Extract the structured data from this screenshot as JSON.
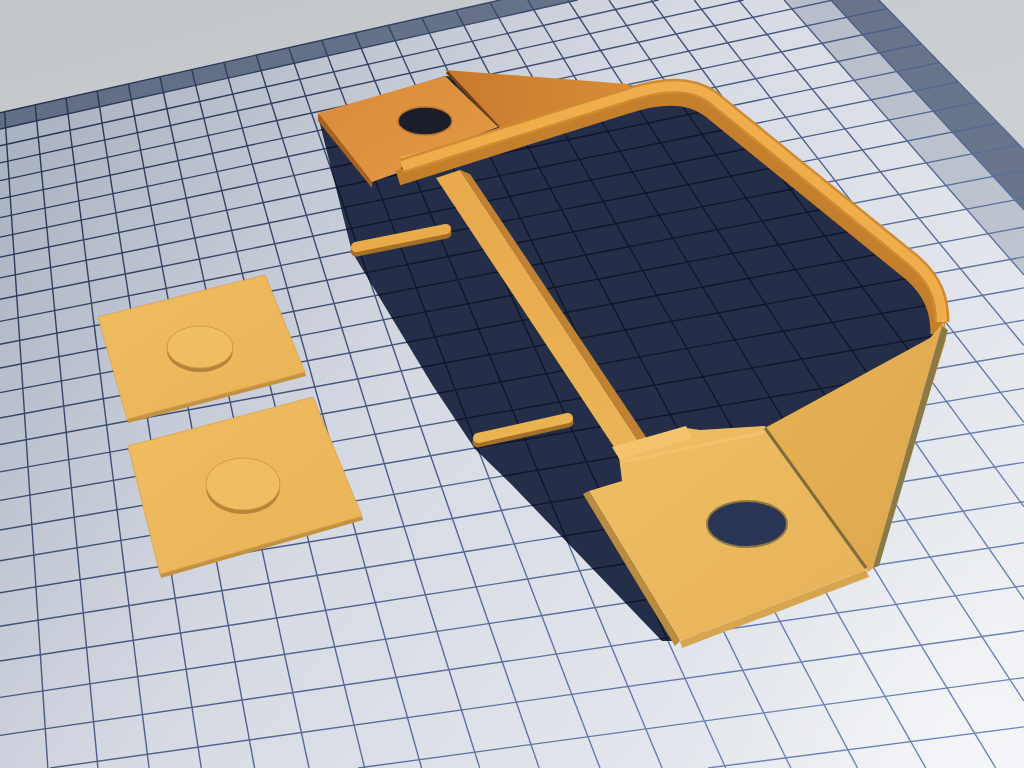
{
  "viewport": {
    "parts": [
      {
        "kind": "bracket"
      },
      {
        "kind": "pad"
      },
      {
        "kind": "pad"
      }
    ]
  }
}
